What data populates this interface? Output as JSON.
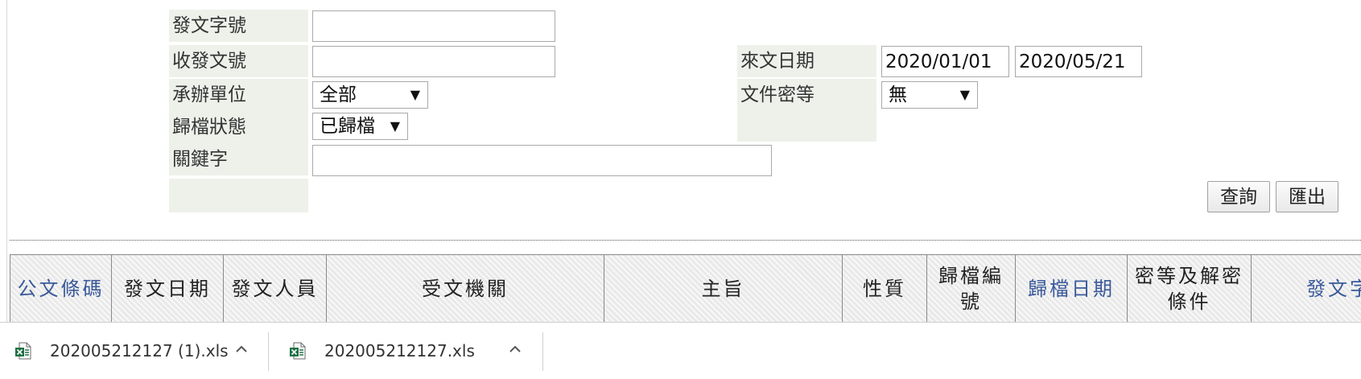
{
  "form": {
    "doc_number_label": "發文字號",
    "doc_number_value": "",
    "recv_send_number_label": "收發文號",
    "recv_send_number_value": "",
    "handling_unit_label": "承辦單位",
    "handling_unit_value": "全部",
    "archive_status_label": "歸檔狀態",
    "archive_status_value": "已歸檔",
    "keyword_label": "關鍵字",
    "keyword_value": "",
    "incoming_date_label": "來文日期",
    "date_from": "2020/01/01",
    "date_to": "2020/05/21",
    "security_level_label": "文件密等",
    "security_level_value": "無"
  },
  "buttons": {
    "search": "查詢",
    "export": "匯出"
  },
  "table": {
    "columns": [
      "公文條碼",
      "發文日期",
      "發文人員",
      "受文機關",
      "主旨",
      "性質",
      "歸檔編號",
      "歸檔日期",
      "密等及解密條件",
      "發文字"
    ]
  },
  "downloads": [
    {
      "filename": "202005212127 (1).xls",
      "icon": "excel-file-icon"
    },
    {
      "filename": "202005212127.xls",
      "icon": "excel-file-icon"
    }
  ],
  "colors": {
    "label_bg": "#eef1ea",
    "link_header": "#3a5a9a",
    "excel_green": "#1e7145"
  }
}
